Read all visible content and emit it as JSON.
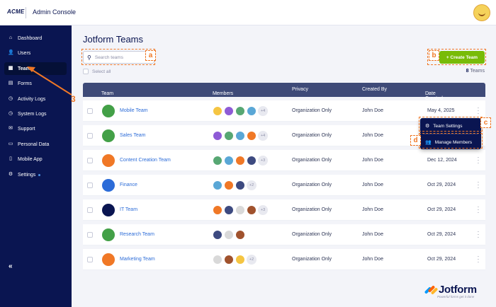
{
  "app": {
    "logo": "ACME",
    "title": "Admin Console"
  },
  "sidebar": {
    "items": [
      {
        "label": "Dashboard",
        "icon": "home-icon"
      },
      {
        "label": "Users",
        "icon": "users-icon"
      },
      {
        "label": "Teams",
        "icon": "teams-icon",
        "active": true
      },
      {
        "label": "Forms",
        "icon": "forms-icon"
      },
      {
        "label": "Activity Logs",
        "icon": "clock-icon"
      },
      {
        "label": "System Logs",
        "icon": "clock-icon"
      },
      {
        "label": "Support",
        "icon": "support-icon"
      },
      {
        "label": "Personal Data",
        "icon": "document-icon"
      },
      {
        "label": "Mobile App",
        "icon": "mobile-icon"
      },
      {
        "label": "Settings",
        "icon": "gear-icon"
      }
    ],
    "collapse": "«"
  },
  "main": {
    "title": "Jotform Teams",
    "search_placeholder": "Search teams",
    "create_button": "+ Create Team",
    "select_all": "Select all",
    "team_count": "8",
    "team_count_label": " Teams"
  },
  "table": {
    "columns": [
      "Team",
      "Members",
      "Privacy",
      "Created By",
      "Date Created"
    ],
    "sort_icon": "⇕",
    "sort_desc_icon": "⇣",
    "rows": [
      {
        "name": "Mobile Team",
        "icon_color": "#43a047",
        "members": 4,
        "extra": "+4",
        "privacy": "Organization Only",
        "created_by": "John Doe",
        "date": "May 4, 2025"
      },
      {
        "name": "Sales Team",
        "icon_color": "#43a047",
        "members": 4,
        "extra": "+4",
        "privacy": "Organization Only",
        "created_by": "John Doe",
        "date": ""
      },
      {
        "name": "Content Creation Team",
        "icon_color": "#f07826",
        "members": 4,
        "extra": "+3",
        "privacy": "Organization Only",
        "created_by": "John Doe",
        "date": "Dec 12, 2024"
      },
      {
        "name": "Finance",
        "icon_color": "#2c6cd8",
        "members": 3,
        "extra": "+2",
        "privacy": "Organization Only",
        "created_by": "John Doe",
        "date": "Oct 29, 2024"
      },
      {
        "name": "IT Team",
        "icon_color": "#0a1551",
        "members": 4,
        "extra": "+3",
        "privacy": "Organization Only",
        "created_by": "John Doe",
        "date": "Oct 29, 2024"
      },
      {
        "name": "Research Team",
        "icon_color": "#43a047",
        "members": 3,
        "extra": "",
        "privacy": "Organization Only",
        "created_by": "John Doe",
        "date": "Oct 29, 2024"
      },
      {
        "name": "Marketing Team",
        "icon_color": "#f07826",
        "members": 3,
        "extra": "+2",
        "privacy": "Organization Only",
        "created_by": "John Doe",
        "date": "Oct 29, 2024"
      }
    ]
  },
  "dropdown": {
    "items": [
      "Team Settings",
      "Manage Members"
    ]
  },
  "callouts": {
    "a": "a",
    "b": "b",
    "c": "c",
    "d": "d",
    "three": "3"
  },
  "footer": {
    "brand": "Jotform",
    "tagline": "Powerful forms get it done"
  },
  "colors": {
    "sidebar": "#0a1551",
    "accent": "#78bb07",
    "link": "#2c6cd8",
    "callout": "#f07826"
  }
}
